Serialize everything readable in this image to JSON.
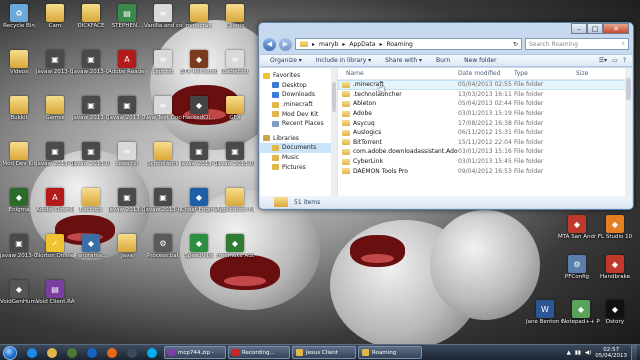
{
  "desktop": {
    "icons": [
      {
        "label": "Recycle Bin",
        "icon": "recycle-bin-icon",
        "color": "#6aa9d9"
      },
      {
        "label": "Cam",
        "icon": "folder-icon",
        "color": "#e1b64a"
      },
      {
        "label": "DICKFACE",
        "icon": "folder-icon",
        "color": "#e1b64a"
      },
      {
        "label": "STEPHEN...",
        "icon": "document-icon",
        "color": "#3a8a4c"
      },
      {
        "label": "Vanilla and co-ords.txt",
        "icon": "text-file-icon",
        "color": "#d9d9d9"
      },
      {
        "label": "minecraft",
        "icon": "folder-icon",
        "color": "#e1b64a"
      },
      {
        "label": "Clients",
        "icon": "folder-icon",
        "color": "#e1b64a"
      },
      {
        "label": "Videos",
        "icon": "folder-icon",
        "color": "#e1b64a"
      },
      {
        "label": "javaw 2013-03-...",
        "icon": "image-file-icon",
        "color": "#4a4a4a"
      },
      {
        "label": "javaw 2013-03-...",
        "icon": "image-file-icon",
        "color": "#4a4a4a"
      },
      {
        "label": "Adobe Reader 9",
        "icon": "adobe-reader-icon",
        "color": "#b31b1b"
      },
      {
        "label": "capt.txt",
        "icon": "text-file-icon",
        "color": "#d9d9d9"
      },
      {
        "label": "BTX Reloaded",
        "icon": "app-icon",
        "color": "#7a3b1f"
      },
      {
        "label": "loaded.txt",
        "icon": "text-file-icon",
        "color": "#d9d9d9"
      },
      {
        "label": "Bukkit",
        "icon": "folder-icon",
        "color": "#e1b64a"
      },
      {
        "label": "Games",
        "icon": "folder-icon",
        "color": "#e1b64a"
      },
      {
        "label": "javaw 2013-03-...",
        "icon": "image-file-icon",
        "color": "#4a4a4a"
      },
      {
        "label": "javaw 2013-03-...",
        "icon": "image-file-icon",
        "color": "#4a4a4a"
      },
      {
        "label": "New Text Document",
        "icon": "text-file-icon",
        "color": "#d9d9d9"
      },
      {
        "label": "HackedCli...",
        "icon": "app-icon",
        "color": "#444444"
      },
      {
        "label": "GFX",
        "icon": "folder-icon",
        "color": "#e1b64a"
      },
      {
        "label": "Mod Dev Kit",
        "icon": "folder-icon",
        "color": "#e1b64a"
      },
      {
        "label": "javaw 2013-03-...",
        "icon": "image-file-icon",
        "color": "#4a4a4a"
      },
      {
        "label": "javaw 2013-03-...",
        "icon": "image-file-icon",
        "color": "#4a4a4a"
      },
      {
        "label": "cows.txt",
        "icon": "text-file-icon",
        "color": "#d9d9d9"
      },
      {
        "label": "Schoolwork",
        "icon": "folder-icon",
        "color": "#e1b64a"
      },
      {
        "label": "javaw 2013-03-...",
        "icon": "image-file-icon",
        "color": "#4a4a4a"
      },
      {
        "label": "javaw 2013-03-...",
        "icon": "image-file-icon",
        "color": "#4a4a4a"
      },
      {
        "label": "Enigma",
        "icon": "app-icon",
        "color": "#2a6b2a"
      },
      {
        "label": "Adobe Downlo...",
        "icon": "adobe-icon",
        "color": "#b31b1b"
      },
      {
        "label": "Backups",
        "icon": "folder-icon",
        "color": "#e1b64a"
      },
      {
        "label": "javaw 2013-03-...",
        "icon": "image-file-icon",
        "color": "#4a4a4a"
      },
      {
        "label": "javaw 2013-03-...",
        "icon": "image-file-icon",
        "color": "#4a4a4a"
      },
      {
        "label": "Cheat Engine",
        "icon": "app-icon",
        "color": "#1f5fa8"
      },
      {
        "label": "Application Files",
        "icon": "folder-icon",
        "color": "#e1b64a"
      },
      {
        "label": "javaw 2013-03-...",
        "icon": "image-file-icon",
        "color": "#4a4a4a"
      },
      {
        "label": "Norton Online",
        "icon": "norton-icon",
        "color": "#f1c232"
      },
      {
        "label": "Panorama...",
        "icon": "app-icon",
        "color": "#3a6ea5"
      },
      {
        "label": "Java",
        "icon": "folder-icon",
        "color": "#e1b64a"
      },
      {
        "label": "Process.bat",
        "icon": "batch-file-icon",
        "color": "#5a5a5a"
      },
      {
        "label": "SpeedVibe",
        "icon": "app-icon",
        "color": "#2b8f3f"
      },
      {
        "label": "Freemake Audio C...",
        "icon": "app-icon",
        "color": "#2e7d32"
      },
      {
        "label": "VoidGenHuman",
        "icon": "app-icon",
        "color": "#555555"
      },
      {
        "label": "Void Client.RAR",
        "icon": "archive-icon",
        "color": "#7b3fa0"
      }
    ],
    "right_icons": [
      {
        "label": "MTA San Andreas 1.3",
        "icon": "app-icon",
        "color": "#c0392b"
      },
      {
        "label": "FL Studio 10",
        "icon": "app-icon",
        "color": "#e67e22"
      },
      {
        "label": "PFConfig",
        "icon": "gear-icon",
        "color": "#5a7fa8"
      },
      {
        "label": "Handbrake",
        "icon": "app-icon",
        "color": "#c0392b"
      },
      {
        "label": "Jane Benton CV.docx",
        "icon": "word-document-icon",
        "color": "#2b5797"
      },
      {
        "label": "Notepad++ Portable",
        "icon": "app-icon",
        "color": "#5aa35a"
      },
      {
        "label": "Dstory",
        "icon": "app-icon",
        "color": "#111111"
      }
    ]
  },
  "explorer": {
    "path": [
      "maryb",
      "AppData",
      "Roaming"
    ],
    "search_placeholder": "Search Roaming",
    "toolbar": {
      "organize": "Organize",
      "include_in_library": "Include in library",
      "share_with": "Share with",
      "burn": "Burn",
      "new_folder": "New folder"
    },
    "nav": [
      {
        "label": "Favorites",
        "icon": "star-icon",
        "head": true
      },
      {
        "label": "Desktop",
        "icon": "desktop-icon",
        "head": false
      },
      {
        "label": "Downloads",
        "icon": "downloads-icon",
        "head": false
      },
      {
        "label": ".minecraft",
        "icon": "folder-icon",
        "head": false
      },
      {
        "label": "Mod Dev Kit",
        "icon": "folder-icon",
        "head": false
      },
      {
        "label": "Recent Places",
        "icon": "recent-places-icon",
        "head": false
      },
      {
        "label": "",
        "icon": "",
        "head": false,
        "spacer": true
      },
      {
        "label": "Libraries",
        "icon": "libraries-icon",
        "head": true
      },
      {
        "label": "Documents",
        "icon": "documents-icon",
        "head": false,
        "selected": true
      },
      {
        "label": "Music",
        "icon": "music-icon",
        "head": false
      },
      {
        "label": "Pictures",
        "icon": "pictures-icon",
        "head": false
      }
    ],
    "columns": {
      "name": "Name",
      "date": "Date modified",
      "type": "Type",
      "size": "Size"
    },
    "files": [
      {
        "name": ".minecraft",
        "date": "05/04/2013 02:55",
        "type": "File folder"
      },
      {
        "name": ".technolauncher",
        "date": "13/03/2013 16:11",
        "type": "File folder"
      },
      {
        "name": "Ableton",
        "date": "05/04/2013 02:44",
        "type": "File folder"
      },
      {
        "name": "Adobe",
        "date": "03/01/2013 15:19",
        "type": "File folder"
      },
      {
        "name": "Asycuq",
        "date": "17/08/2012 16:38",
        "type": "File folder"
      },
      {
        "name": "Auslogics",
        "date": "06/11/2012 15:31",
        "type": "File folder"
      },
      {
        "name": "BitTorrent",
        "date": "15/11/2012 22:04",
        "type": "File folder"
      },
      {
        "name": "com.adobe.downloadassistant.AdobeDo...",
        "date": "03/01/2013 15:16",
        "type": "File folder"
      },
      {
        "name": "CyberLink",
        "date": "03/01/2013 15:45",
        "type": "File folder"
      },
      {
        "name": "DAEMON Tools Pro",
        "date": "09/04/2012 16:53",
        "type": "File folder"
      }
    ],
    "status": "51 items",
    "hover_index": 0
  },
  "taskbar": {
    "pinned": [
      {
        "icon": "internet-explorer-icon",
        "color": "#1e88e5"
      },
      {
        "icon": "windows-explorer-icon",
        "color": "#e1b64a"
      },
      {
        "icon": "minecraft-icon",
        "color": "#4c7a32"
      },
      {
        "icon": "media-player-icon",
        "color": "#1565c0"
      },
      {
        "icon": "firefox-icon",
        "color": "#e8661a"
      },
      {
        "icon": "steam-icon",
        "color": "#3a4a5c"
      },
      {
        "icon": "skype-icon",
        "color": "#00aff0"
      }
    ],
    "tasks": [
      {
        "label": "mcp744.zip -",
        "icon": "winrar-icon",
        "color": "#7b3fa0"
      },
      {
        "label": "Recording...",
        "icon": "record-icon",
        "color": "#c62828"
      },
      {
        "label": "Jesus Client",
        "icon": "folder-icon",
        "color": "#e1b64a"
      },
      {
        "label": "Roaming",
        "icon": "folder-icon",
        "color": "#e1b64a"
      }
    ],
    "time": "02:57",
    "date": "05/04/2013"
  }
}
